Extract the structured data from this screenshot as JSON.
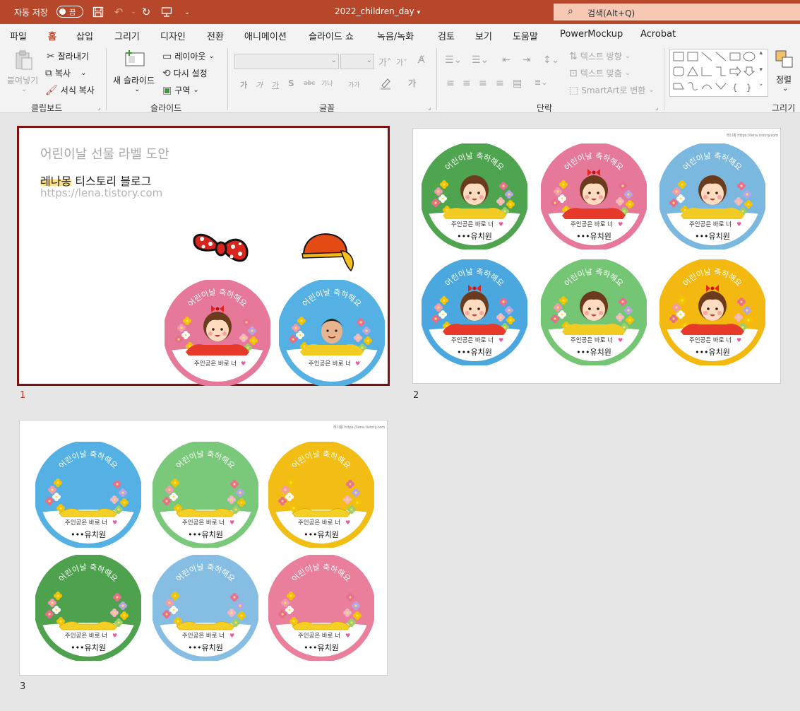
{
  "titlebar": {
    "autosave_label": "자동 저장",
    "autosave_state": "끔",
    "doc_title": "2022_children_day",
    "search_placeholder": "검색(Alt+Q)",
    "accent": "#b7472a"
  },
  "tabs": [
    "파일",
    "홈",
    "삽입",
    "그리기",
    "디자인",
    "전환",
    "애니메이션",
    "슬라이드 쇼",
    "녹음/녹화",
    "검토",
    "보기",
    "도움말",
    "PowerMockup",
    "Acrobat"
  ],
  "active_tab": "홈",
  "ribbon": {
    "clipboard": {
      "paste": "붙여넣기",
      "cut": "잘라내기",
      "copy": "복사",
      "format_painter": "서식 복사",
      "label": "클립보드"
    },
    "slides": {
      "new_slide": "새 슬라이드",
      "layout": "레이아웃",
      "reset": "다시 설정",
      "section": "구역",
      "label": "슬라이드"
    },
    "font": {
      "label": "글꼴",
      "bold": "가",
      "italic": "가",
      "underline": "가",
      "strike": "S",
      "abc": "abc",
      "spacing": "가나",
      "case": "가가",
      "color": "가"
    },
    "paragraph": {
      "label": "단락",
      "text_direction": "텍스트 방향",
      "align_text": "텍스트 맞춤",
      "smartart": "SmartArt로 변환"
    },
    "drawing": {
      "arrange": "정렬",
      "label": "그리기"
    }
  },
  "slides": [
    {
      "number": "1",
      "title": "어린이날 선물 라벨 도안",
      "subtitle_highlight": "레나몽",
      "subtitle_rest": " 티스토리 블로그",
      "url": "https://lena.tistory.com"
    },
    {
      "number": "2",
      "credit": "레나몽 https://lena.tistory.com"
    },
    {
      "number": "3",
      "credit": "레나몽 https://lena.tistory.com"
    }
  ],
  "labels": {
    "arc_text": "어린이날 축하해요",
    "message": "주인공은 바로 너",
    "school": "•••유치원"
  },
  "slide2_rings": [
    "#4fa44f",
    "#e6799a",
    "#7ab8e0",
    "#4aa8de",
    "#74c674",
    "#f3b910"
  ],
  "slide3_rings": [
    "#55b1e3",
    "#7ac87a",
    "#f2bd14",
    "#4ea24e",
    "#86bee3",
    "#e97f9b"
  ],
  "slide1_rings": [
    "#e6799a",
    "#55b1e3"
  ]
}
